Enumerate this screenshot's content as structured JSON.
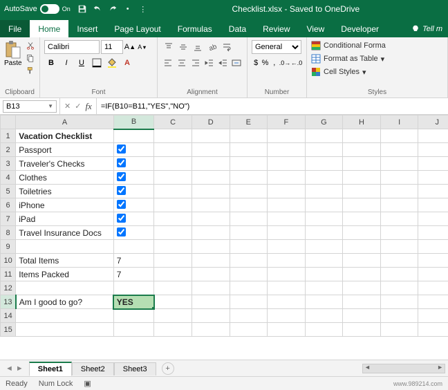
{
  "titlebar": {
    "autosave_label": "AutoSave",
    "autosave_state": "On",
    "doc_title": "Checklist.xlsx - Saved to OneDrive"
  },
  "tabs": {
    "file": "File",
    "home": "Home",
    "insert": "Insert",
    "page_layout": "Page Layout",
    "formulas": "Formulas",
    "data": "Data",
    "review": "Review",
    "view": "View",
    "developer": "Developer",
    "tellme": "Tell m"
  },
  "ribbon": {
    "clipboard": {
      "paste": "Paste",
      "label": "Clipboard"
    },
    "font": {
      "name": "Calibri",
      "size": "11",
      "label": "Font"
    },
    "alignment": {
      "label": "Alignment"
    },
    "number": {
      "format": "General",
      "label": "Number"
    },
    "styles": {
      "conditional": "Conditional Forma",
      "table": "Format as Table",
      "cell": "Cell Styles",
      "label": "Styles"
    }
  },
  "fbar": {
    "namebox": "B13",
    "formula": "=IF(B10=B11,\"YES\",\"NO\")"
  },
  "columns": [
    "A",
    "B",
    "C",
    "D",
    "E",
    "F",
    "G",
    "H",
    "I",
    "J"
  ],
  "rows": [
    {
      "n": 1,
      "A": "Vacation Checklist",
      "bold": true
    },
    {
      "n": 2,
      "A": "Passport",
      "B_check": true
    },
    {
      "n": 3,
      "A": "Traveler's Checks",
      "B_check": true
    },
    {
      "n": 4,
      "A": "Clothes",
      "B_check": true
    },
    {
      "n": 5,
      "A": "Toiletries",
      "B_check": true
    },
    {
      "n": 6,
      "A": "iPhone",
      "B_check": true
    },
    {
      "n": 7,
      "A": "iPad",
      "B_check": true
    },
    {
      "n": 8,
      "A": "Travel Insurance Docs",
      "B_check": true
    },
    {
      "n": 9
    },
    {
      "n": 10,
      "A": "Total Items",
      "B": "7"
    },
    {
      "n": 11,
      "A": "Items Packed",
      "B": "7"
    },
    {
      "n": 12
    },
    {
      "n": 13,
      "A": "Am I good to go?",
      "B": "YES",
      "sel": true
    },
    {
      "n": 14
    },
    {
      "n": 15
    }
  ],
  "sheets": {
    "active": "Sheet1",
    "s2": "Sheet2",
    "s3": "Sheet3"
  },
  "status": {
    "ready": "Ready",
    "numlock": "Num Lock",
    "watermark": "www.989214.com"
  }
}
